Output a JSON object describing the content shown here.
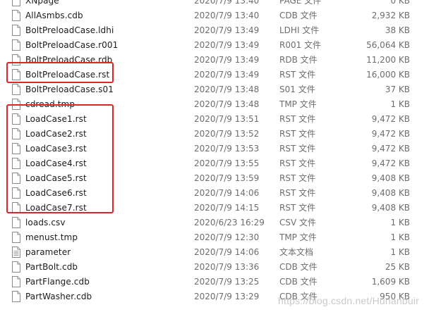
{
  "files": [
    {
      "name": "XNpage",
      "date": "2020/7/9 13:40",
      "type": "PAGE 文件",
      "size": "0 KB"
    },
    {
      "name": "AllAsmbs.cdb",
      "date": "2020/7/9 13:40",
      "type": "CDB 文件",
      "size": "2,932 KB"
    },
    {
      "name": "BoltPreloadCase.ldhi",
      "date": "2020/7/9 13:49",
      "type": "LDHI 文件",
      "size": "38 KB"
    },
    {
      "name": "BoltPreloadCase.r001",
      "date": "2020/7/9 13:49",
      "type": "R001 文件",
      "size": "56,064 KB"
    },
    {
      "name": "BoltPreloadCase.rdb",
      "date": "2020/7/9 13:49",
      "type": "RDB 文件",
      "size": "11,200 KB"
    },
    {
      "name": "BoltPreloadCase.rst",
      "date": "2020/7/9 13:49",
      "type": "RST 文件",
      "size": "16,000 KB"
    },
    {
      "name": "BoltPreloadCase.s01",
      "date": "2020/7/9 13:48",
      "type": "S01 文件",
      "size": "37 KB"
    },
    {
      "name": "cdread.tmp",
      "date": "2020/7/9 13:48",
      "type": "TMP 文件",
      "size": "1 KB"
    },
    {
      "name": "LoadCase1.rst",
      "date": "2020/7/9 13:51",
      "type": "RST 文件",
      "size": "9,472 KB"
    },
    {
      "name": "LoadCase2.rst",
      "date": "2020/7/9 13:52",
      "type": "RST 文件",
      "size": "9,472 KB"
    },
    {
      "name": "LoadCase3.rst",
      "date": "2020/7/9 13:53",
      "type": "RST 文件",
      "size": "9,472 KB"
    },
    {
      "name": "LoadCase4.rst",
      "date": "2020/7/9 13:55",
      "type": "RST 文件",
      "size": "9,472 KB"
    },
    {
      "name": "LoadCase5.rst",
      "date": "2020/7/9 13:59",
      "type": "RST 文件",
      "size": "9,408 KB"
    },
    {
      "name": "LoadCase6.rst",
      "date": "2020/7/9 14:06",
      "type": "RST 文件",
      "size": "9,408 KB"
    },
    {
      "name": "LoadCase7.rst",
      "date": "2020/7/9 14:15",
      "type": "RST 文件",
      "size": "9,408 KB"
    },
    {
      "name": "loads.csv",
      "date": "2020/6/23 16:29",
      "type": "CSV 文件",
      "size": "1 KB"
    },
    {
      "name": "menust.tmp",
      "date": "2020/7/9 12:30",
      "type": "TMP 文件",
      "size": "1 KB"
    },
    {
      "name": "parameter",
      "date": "2020/7/9 14:06",
      "type": "文本文档",
      "size": "1 KB"
    },
    {
      "name": "PartBolt.cdb",
      "date": "2020/7/9 13:36",
      "type": "CDB 文件",
      "size": "25 KB"
    },
    {
      "name": "PartFlange.cdb",
      "date": "2020/7/9 13:25",
      "type": "CDB 文件",
      "size": "1,609 KB"
    },
    {
      "name": "PartWasher.cdb",
      "date": "2020/7/9 13:29",
      "type": "CDB 文件",
      "size": "950 KB"
    }
  ],
  "icon": "document-icon",
  "highlight_color": "#e0242b",
  "watermark": "https://blog.csdn.net/Hunanbuir"
}
